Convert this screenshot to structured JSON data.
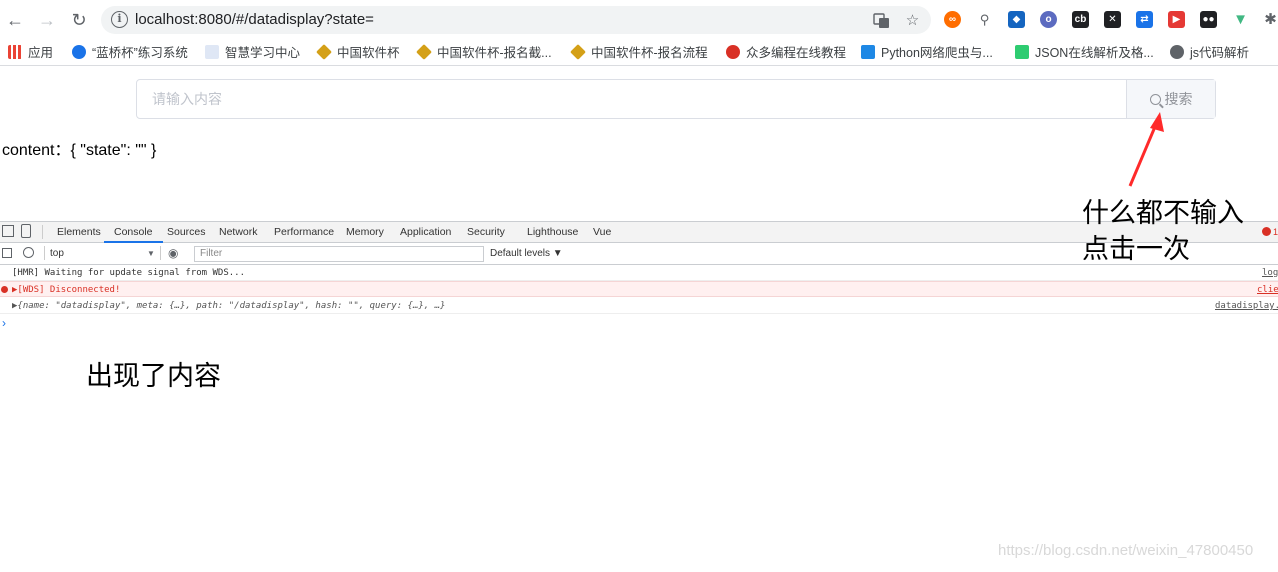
{
  "browser": {
    "url": "localhost:8080/#/datadisplay?state="
  },
  "bookmarks": [
    {
      "label": "应用",
      "color": "#4285f4"
    },
    {
      "label": "“蓝桥杯”练习系统",
      "color": "#1a73e8"
    },
    {
      "label": "智慧学习中心",
      "color": "#dfe7f5"
    },
    {
      "label": "中国软件杯",
      "color": "#d4a017"
    },
    {
      "label": "中国软件杯-报名截...",
      "color": "#d4a017"
    },
    {
      "label": "中国软件杯-报名流程",
      "color": "#d4a017"
    },
    {
      "label": "众多编程在线教程",
      "color": "#d93025"
    },
    {
      "label": "Python网络爬虫与...",
      "color": "#1e88e5"
    },
    {
      "label": "JSON在线解析及格...",
      "color": "#2ecc71"
    },
    {
      "label": "js代码解析",
      "color": "#5f6368"
    }
  ],
  "page": {
    "search_placeholder": "请输入内容",
    "search_button": "搜索",
    "content_label": "content：{ \"state\": \"\" }"
  },
  "annotations": {
    "top_right_line1": "什么都不输入",
    "top_right_line2": "点击一次",
    "bottom_left": "出现了内容"
  },
  "devtools": {
    "tabs": [
      "Elements",
      "Console",
      "Sources",
      "Network",
      "Performance",
      "Memory",
      "Application",
      "Security",
      "Lighthouse",
      "Vue"
    ],
    "active_tab": "Console",
    "error_count": "1",
    "context": "top",
    "filter_placeholder": "Filter",
    "levels": "Default levels ▼",
    "logs": [
      {
        "text": "[HMR] Waiting for update signal from WDS...",
        "source": "log",
        "type": "info"
      },
      {
        "text": "▶[WDS] Disconnected!",
        "source": "clie",
        "type": "error"
      },
      {
        "text": "▶{name: \"datadisplay\", meta: {…}, path: \"/datadisplay\", hash: \"\", query: {…}, …}",
        "source": "datadisplay.",
        "type": "object"
      }
    ],
    "prompt": "›"
  },
  "watermark": "https://blog.csdn.net/weixin_47800450",
  "colors": {
    "accent": "#1a73e8",
    "error_bg": "#fff0f0",
    "error_text": "#d93025",
    "arrow": "#ff2a2a"
  }
}
